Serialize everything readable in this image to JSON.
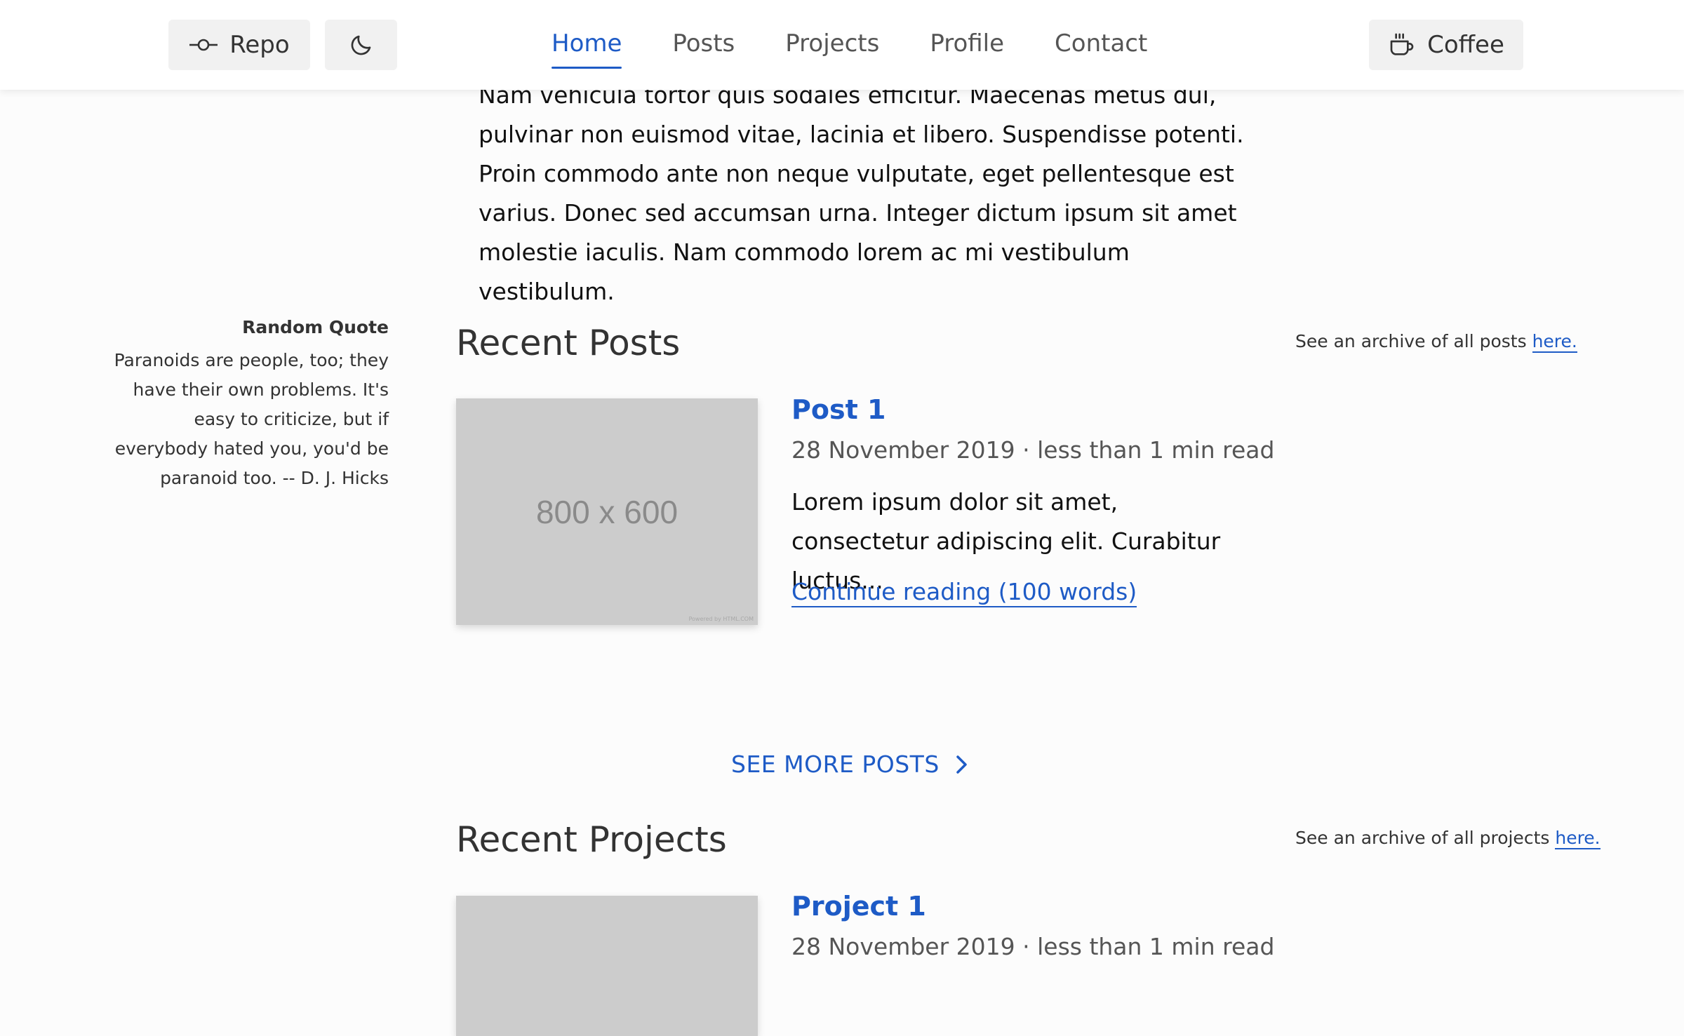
{
  "header": {
    "repo_label": "Repo",
    "theme_toggle_icon": "moon-icon",
    "nav": [
      {
        "label": "Home",
        "active": true
      },
      {
        "label": "Posts",
        "active": false
      },
      {
        "label": "Projects",
        "active": false
      },
      {
        "label": "Profile",
        "active": false
      },
      {
        "label": "Contact",
        "active": false
      }
    ],
    "coffee_label": "Coffee"
  },
  "intro": {
    "lines": [
      "Nam vehicula tortor quis sodales efficitur. Maecenas metus dui,",
      "pulvinar non euismod vitae, lacinia et libero. Suspendisse potenti.",
      "Proin commodo ante non neque vulputate, eget pellentesque est",
      "varius. Donec sed accumsan urna. Integer dictum ipsum sit amet",
      "molestie iaculis. Nam commodo lorem ac mi vestibulum vestibulum."
    ]
  },
  "quote": {
    "title": "Random Quote",
    "text": "Paranoids are people, too; they have their own problems. It's easy to criticize, but if everybody hated you, you'd be paranoid too. -- D. J. Hicks"
  },
  "posts": {
    "title": "Recent Posts",
    "archive_prefix": "See an archive of all posts",
    "archive_link": "here.",
    "items": [
      {
        "thumb_label": "800 x 600",
        "thumb_credit": "Powered by HTML.COM",
        "title": "Post 1",
        "meta": "28 November 2019 · less than 1 min read",
        "excerpt": "Lorem ipsum dolor sit amet, consectetur adipiscing elit. Curabitur luctus...",
        "more": "Continue reading (100 words)"
      }
    ],
    "see_more": "SEE MORE POSTS"
  },
  "projects": {
    "title": "Recent Projects",
    "archive_prefix": "See an archive of all projects",
    "archive_link": "here.",
    "items": [
      {
        "title": "Project 1",
        "meta": "28 November 2019 · less than 1 min read"
      }
    ]
  },
  "colors": {
    "accent": "#1e5bc6",
    "background": "#fcfcfc",
    "header": "#ffffff",
    "thumb": "#cccccc"
  }
}
